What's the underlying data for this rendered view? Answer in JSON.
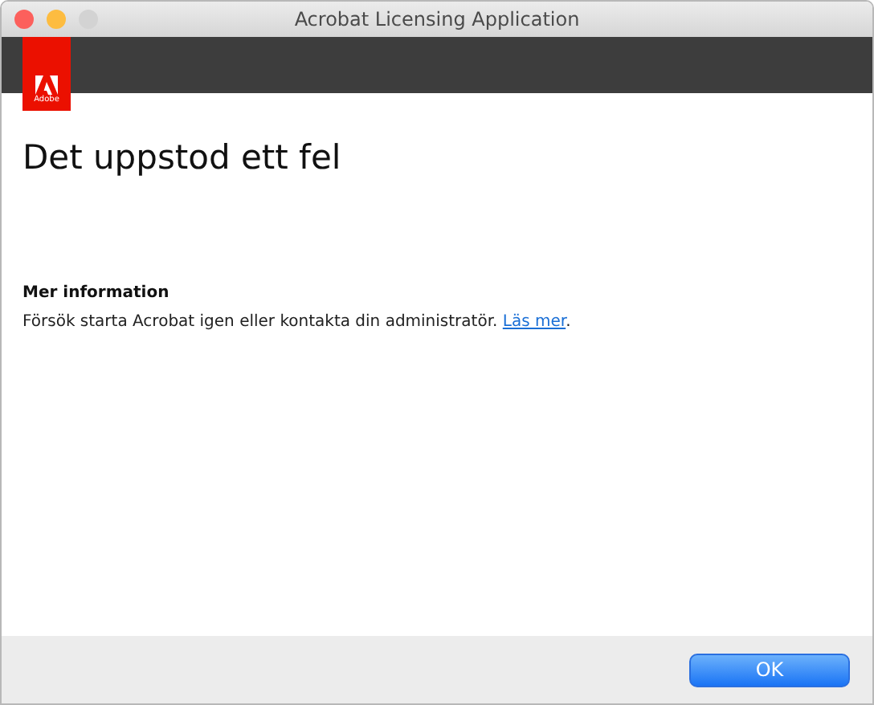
{
  "window": {
    "title": "Acrobat Licensing Application"
  },
  "logo": {
    "text": "Adobe"
  },
  "heading": "Det uppstod ett fel",
  "info": {
    "title": "Mer information",
    "text": "Försök starta Acrobat igen eller kontakta din administratör. ",
    "link": "Läs mer",
    "text_after": "."
  },
  "buttons": [
    {
      "label": "OK",
      "default": true
    }
  ]
}
